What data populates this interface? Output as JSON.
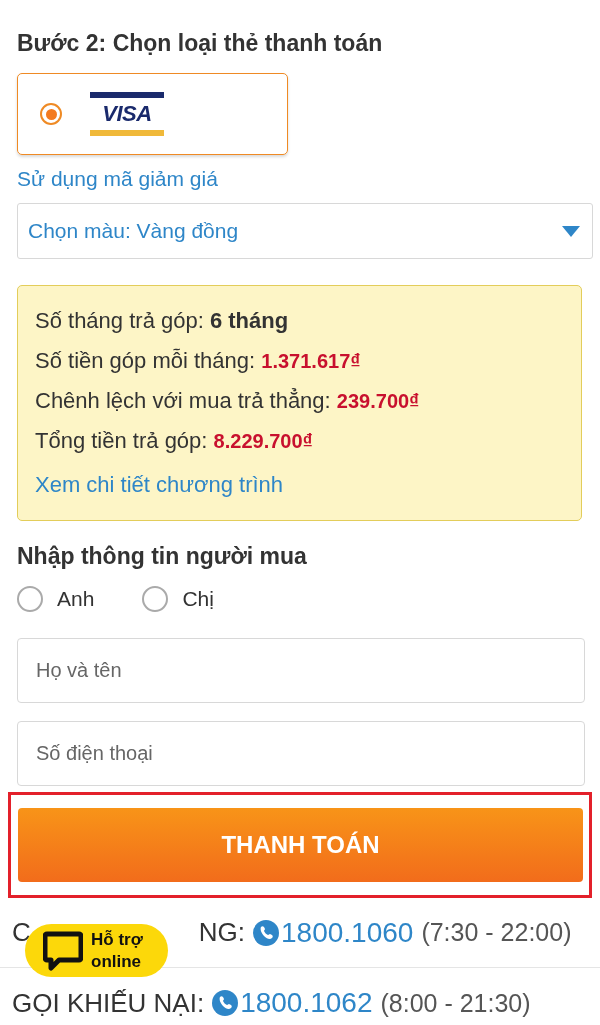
{
  "step_title": "Bước 2: Chọn loại thẻ thanh toán",
  "cards": [
    {
      "kind": "visa",
      "brand": "VISA",
      "selected": true
    }
  ],
  "coupon_link": "Sử dụng mã giảm giá",
  "color_select": {
    "value": "Chọn màu: Vàng đồng"
  },
  "summary": {
    "rows": [
      {
        "label": "Số tháng trả góp:",
        "value": "6 tháng",
        "kind": "plain"
      },
      {
        "label": "Số tiền góp mỗi tháng:",
        "value": "1.371.617₫",
        "kind": "money"
      },
      {
        "label": "Chênh lệch với mua trả thẳng:",
        "value": "239.700₫",
        "kind": "money"
      },
      {
        "label": "Tổng tiền trả góp:",
        "value": "8.229.700₫",
        "kind": "money"
      }
    ],
    "link": "Xem chi tiết chương trình"
  },
  "buyer_title": "Nhập thông tin người mua",
  "genders": [
    {
      "label": "Anh",
      "selected": false
    },
    {
      "label": "Chị",
      "selected": false
    }
  ],
  "fields": [
    {
      "placeholder": "Họ và tên"
    },
    {
      "placeholder": "Số điện thoại"
    }
  ],
  "pay_button": {
    "label": "THANH TOÁN",
    "highlighted": true
  },
  "hotlines": [
    {
      "label_start": "C",
      "label_end": "NG:",
      "number": "1800.1060",
      "hours": "(7:30 - 22:00)"
    },
    {
      "label_start": "GỌI KHIẾU NẠI:",
      "number": "1800.1062",
      "hours": "(8:00 - 21:30)"
    }
  ],
  "chat_badge": {
    "label": "Hỗ trợ online"
  }
}
